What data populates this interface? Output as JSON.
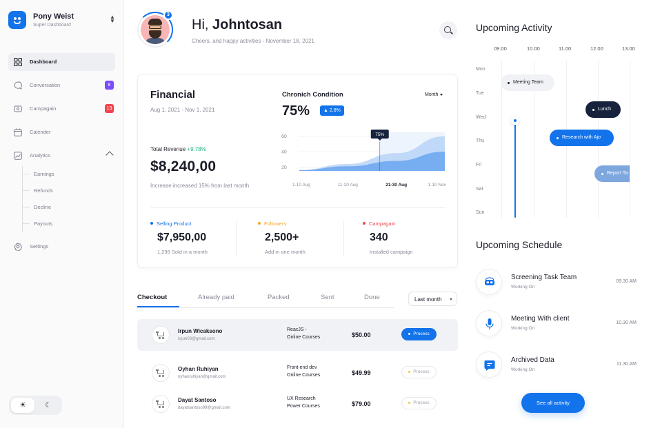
{
  "sidebar": {
    "brand_name": "Pony Weist",
    "brand_sub": "Super Dashboard",
    "items": [
      {
        "label": "Dashboard",
        "icon": "grid-icon",
        "active": true
      },
      {
        "label": "Conversation",
        "icon": "chat-icon",
        "badge": "8",
        "badge_color": "#7b4cff"
      },
      {
        "label": "Campagain",
        "icon": "campaign-icon",
        "badge": "13",
        "badge_color": "#f0454e"
      },
      {
        "label": "Calender",
        "icon": "calendar-icon"
      },
      {
        "label": "Analytics",
        "icon": "analytics-icon",
        "expanded": true
      },
      {
        "label": "Settings",
        "icon": "gear-icon"
      }
    ],
    "analytics_sub": [
      "Earnings",
      "Refunds",
      "Decline",
      "Payouts"
    ],
    "theme": {
      "light_icon": "sun-icon",
      "dark_icon": "moon-icon",
      "selected": "light"
    }
  },
  "header": {
    "greeting_hi": "Hi,",
    "greeting_name": "Johntosan",
    "subtitle": "Cheers, and happy activities - November 18, 2021",
    "avatar_badge": "3"
  },
  "financial": {
    "title": "Financial",
    "date_range": "Aug 1, 2021 - Nov 1, 2021",
    "revenue_label": "Total Revenue",
    "revenue_change": "+9.78%",
    "revenue_value": "$8,240,00",
    "revenue_note": "Increase increased 15% from last month",
    "condition": {
      "title": "Chronich Condition",
      "period": "Month",
      "value": "75%",
      "badge": "2,8%",
      "tooltip": "75%"
    },
    "stats": [
      {
        "label": "Selling Product",
        "value": "$7,950,00",
        "note": "1,298 Sold in a month",
        "color": "#1273eb"
      },
      {
        "label": "Followers",
        "value": "2,500+",
        "note": "Add in one month",
        "color": "#f4a72a"
      },
      {
        "label": "Campagain",
        "value": "340",
        "note": "Installed campaign",
        "color": "#f0454e"
      }
    ]
  },
  "chart_data": {
    "type": "area",
    "categories": [
      "1-10 Aug",
      "11-20 Aug",
      "21-30 Aug",
      "1-10 Nov"
    ],
    "highlight_category": "21-30 Aug",
    "y_ticks": [
      "60",
      "40",
      "20"
    ],
    "ylim": [
      15,
      65
    ],
    "series": [
      {
        "values": [
          16,
          24,
          38,
          60
        ],
        "color": "#b9d4f7"
      },
      {
        "values": [
          16,
          21,
          28,
          40
        ],
        "color": "#6fa7ef"
      }
    ]
  },
  "orders": {
    "tabs": [
      "Checkout",
      "Already paid",
      "Packed",
      "Sent",
      "Done"
    ],
    "active_tab": "Checkout",
    "filter_label": "Last month",
    "rows": [
      {
        "name": "Irpun Wicaksono",
        "email": "irpun03@gmail.com",
        "course_line1": "ReacJS -",
        "course_line2": "Online Courses",
        "price": "$50.00",
        "status": "Process",
        "style": "primary",
        "highlight": true
      },
      {
        "name": "Oyhan Ruhiyan",
        "email": "oyhanruhiyan@gmail.com",
        "course_line1": "Front-end dev",
        "course_line2": "Online Courses",
        "price": "$49.99",
        "status": "Process",
        "style": "muted",
        "highlight": false
      },
      {
        "name": "Dayat Santoso",
        "email": "dayatsantoso99@gmail.com",
        "course_line1": "UX Research",
        "course_line2": "Power Courses",
        "price": "$79.00",
        "status": "Process",
        "style": "muted",
        "highlight": false
      }
    ]
  },
  "activity": {
    "title": "Upcoming Activity",
    "times": [
      "09.00",
      "10.00",
      "11.00",
      "12.00",
      "13.00"
    ],
    "days": [
      "Mon",
      "Tue",
      "Wed",
      "Thu",
      "Fri",
      "Sat",
      "Sun"
    ],
    "events": [
      {
        "label": "Meeting Team",
        "day": "Mon",
        "start": "09.00",
        "style": "light"
      },
      {
        "label": "Lunch",
        "day": "Wed",
        "start": "12.00",
        "style": "dark"
      },
      {
        "label": "Research with Ajo",
        "day": "Thu",
        "start": "10.00",
        "style": "blue"
      },
      {
        "label": "Report Ta",
        "day": "Fri",
        "start": "12.00",
        "style": "faded"
      }
    ]
  },
  "schedule": {
    "title": "Upcoming Schedule",
    "items": [
      {
        "title": "Screening Task Team",
        "status": "Working On",
        "time": "09.30 AM",
        "icon": "vr-headset-icon"
      },
      {
        "title": "Meeting With client",
        "status": "Working On",
        "time": "10.30 AM",
        "icon": "microphone-icon"
      },
      {
        "title": "Archived Data",
        "status": "Working On",
        "time": "11.30 AM",
        "icon": "message-icon"
      }
    ],
    "see_all_label": "See all activity"
  },
  "colors": {
    "accent": "#1273eb",
    "dark": "#17233d",
    "positive": "#22b07d"
  }
}
